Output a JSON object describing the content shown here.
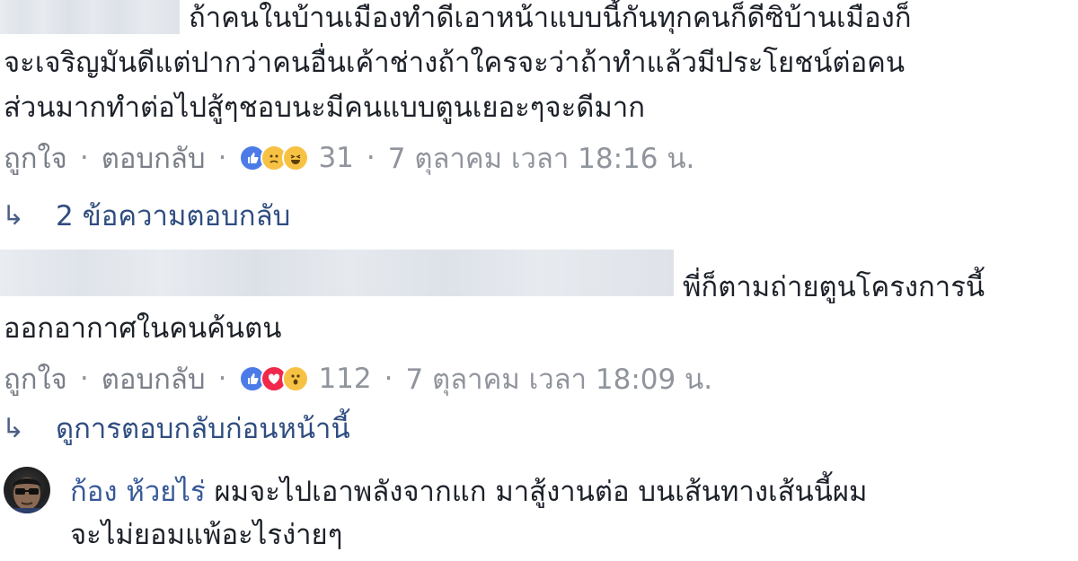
{
  "comments": [
    {
      "text_lines": [
        "ถ้าคนในบ้านเมืองทำดีเอาหน้าแบบนี้กันทุกคนก็ดีซิบ้านเมืองก็",
        "จะเจริญมันดีแต่ปากว่าคนอื่นเค้าช่างถ้าใครจะว่าถ้าทำแล้วมีประโยชน์ต่อคน",
        "ส่วนมากทำต่อไปสู้ๆชอบนะมีคนแบบตูนเยอะๆจะดีมาก"
      ],
      "like_label": "ถูกใจ",
      "reply_label": "ตอบกลับ",
      "reaction_count": "31",
      "timestamp": "7 ตุลาคม เวลา 18:16 น.",
      "replies_link": "2 ข้อความตอบกลับ"
    },
    {
      "text_lines": [
        "พี่ก็ตามถ่ายตูนโครงการนี้",
        "ออกอากาศในคนค้นตน"
      ],
      "like_label": "ถูกใจ",
      "reply_label": "ตอบกลับ",
      "reaction_count": "112",
      "timestamp": "7 ตุลาคม เวลา 18:09 น.",
      "replies_link": "ดูการตอบกลับก่อนหน้านี้"
    }
  ],
  "reply": {
    "author": "ก้อง ห้วยไร่",
    "text_line1": "ผมจะไปเอาพลังจากแก มาสู้งานต่อ บนเส้นทางเส้นนี้ผม",
    "text_line2": "จะไม่ยอมแพ้อะไรง่ายๆ"
  },
  "icons": {
    "reply_arrow": "↳",
    "dot": "·"
  },
  "colors": {
    "link": "#365899",
    "meta": "#90949c",
    "like": "#4c7be8",
    "love": "#f0284a",
    "emoji": "#f7c244"
  }
}
